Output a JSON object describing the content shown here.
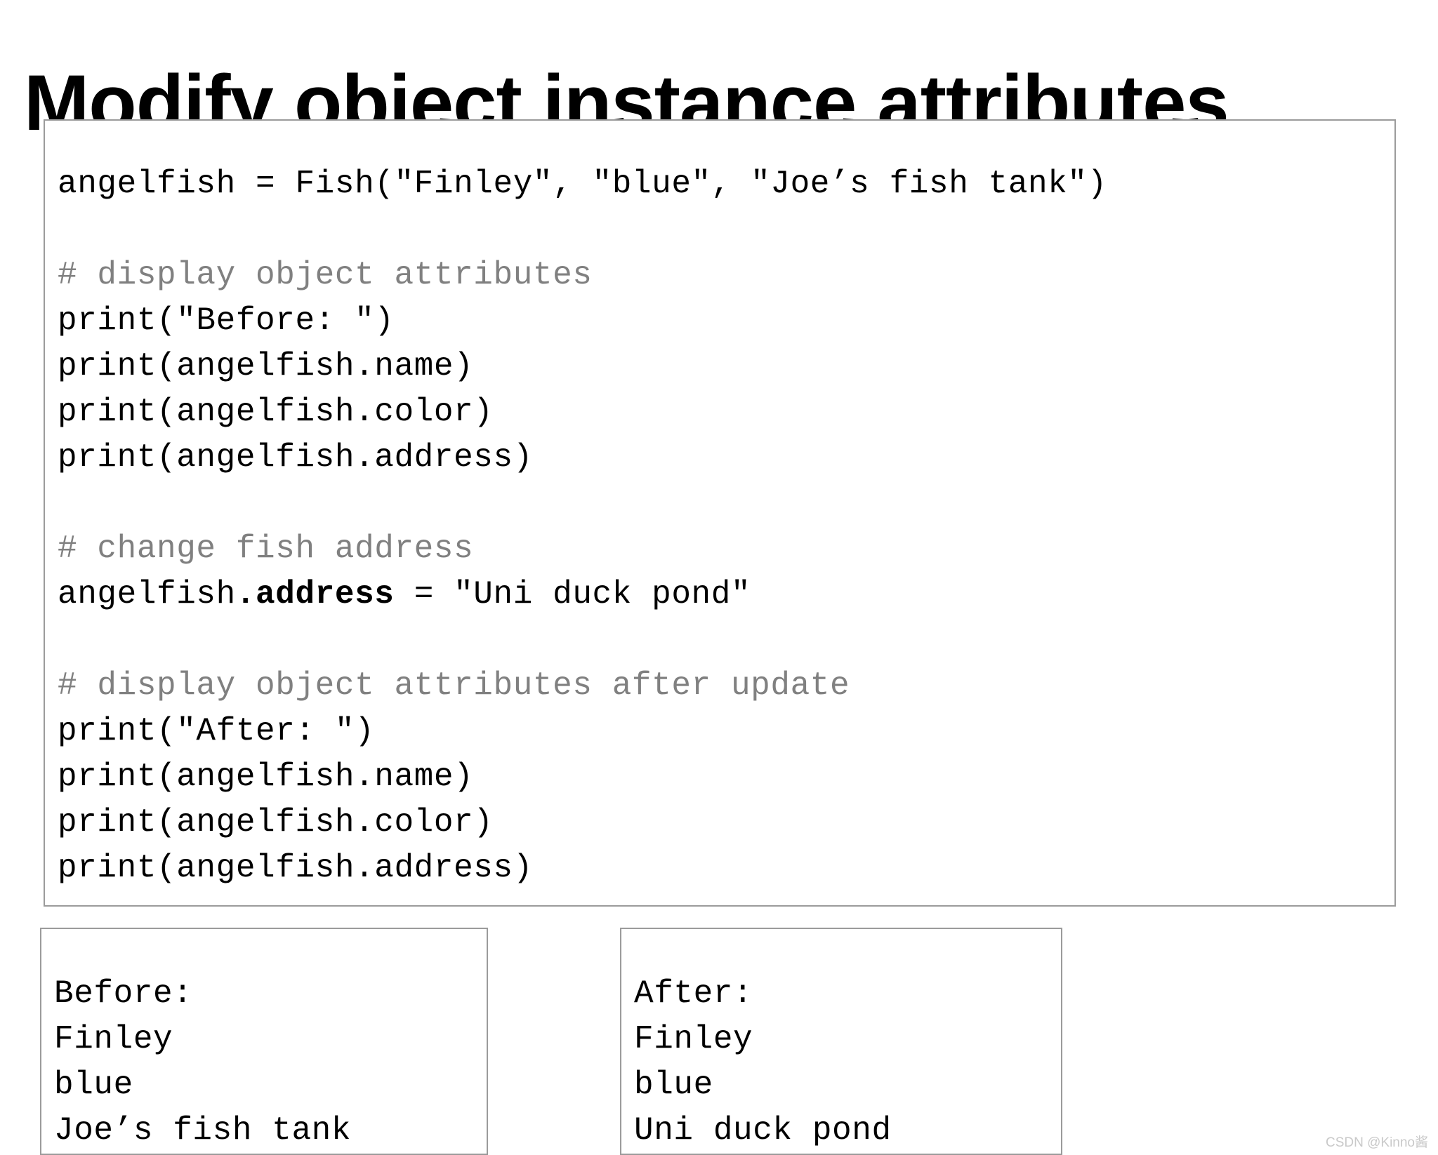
{
  "page": {
    "title": "Modify object instance attributes",
    "background_color": "#ffffff",
    "text_color": "#000000",
    "comment_color": "#808080",
    "border_color": "#9b9b9b"
  },
  "code_block": {
    "language": "python",
    "lines": [
      {
        "id": "line-1",
        "type": "code",
        "text": "angelfish = Fish(\"Finley\", \"blue\", \"Joe’s fish tank\")"
      },
      {
        "id": "line-2",
        "type": "blank",
        "text": ""
      },
      {
        "id": "line-3",
        "type": "comment",
        "text": "# display object attributes"
      },
      {
        "id": "line-4",
        "type": "code",
        "text": "print(\"Before: \")"
      },
      {
        "id": "line-5",
        "type": "code",
        "text": "print(angelfish.name)"
      },
      {
        "id": "line-6",
        "type": "code",
        "text": "print(angelfish.color)"
      },
      {
        "id": "line-7",
        "type": "code",
        "text": "print(angelfish.address)"
      },
      {
        "id": "line-8",
        "type": "blank",
        "text": ""
      },
      {
        "id": "line-9",
        "type": "comment",
        "text": "# change fish address"
      },
      {
        "id": "line-10",
        "type": "code-bold-attr",
        "prefix": "angelfish",
        "bold": ".address",
        "suffix": " = \"Uni duck pond\"",
        "text": "angelfish.address = \"Uni duck pond\""
      },
      {
        "id": "line-11",
        "type": "blank",
        "text": ""
      },
      {
        "id": "line-12",
        "type": "comment",
        "text": "# display object attributes after update"
      },
      {
        "id": "line-13",
        "type": "code",
        "text": "print(\"After: \")"
      },
      {
        "id": "line-14",
        "type": "code",
        "text": "print(angelfish.name)"
      },
      {
        "id": "line-15",
        "type": "code",
        "text": "print(angelfish.color)"
      },
      {
        "id": "line-16",
        "type": "code",
        "text": "print(angelfish.address)"
      }
    ]
  },
  "output_before": {
    "lines": [
      "Before:",
      "Finley",
      "blue",
      "Joe’s fish tank"
    ]
  },
  "output_after": {
    "lines": [
      "After:",
      "Finley",
      "blue",
      "Uni duck pond"
    ]
  },
  "watermark": {
    "text": "CSDN @Kinno酱"
  }
}
